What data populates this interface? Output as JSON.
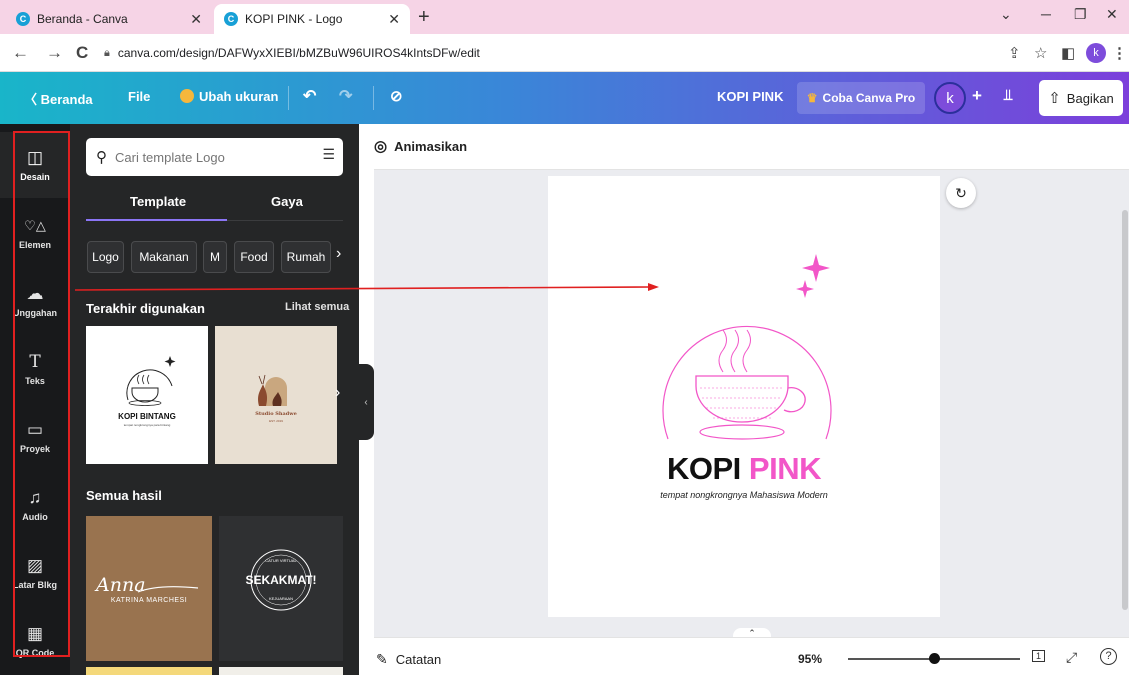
{
  "browser": {
    "tabs": [
      {
        "title": "Beranda - Canva",
        "active": false
      },
      {
        "title": "KOPI PINK - Logo",
        "active": true
      }
    ],
    "new_tab": "+",
    "url": "canva.com/design/DAFWyxXIEBI/bMZBuW96UIROS4kIntsDFw/edit",
    "profile_initial": "k"
  },
  "topbar": {
    "home_label": "Beranda",
    "file_label": "File",
    "resize_label": "Ubah ukuran",
    "design_title": "KOPI PINK",
    "pro_label": "Coba Canva Pro",
    "avatar_initial": "k",
    "add_label": "+",
    "share_label": "Bagikan"
  },
  "rail": {
    "items": [
      {
        "label": "Desain",
        "icon": "layout-icon",
        "glyph": "◫"
      },
      {
        "label": "Elemen",
        "icon": "shapes-icon",
        "glyph": "♡△"
      },
      {
        "label": "Unggahan",
        "icon": "cloud-upload-icon",
        "glyph": "☁"
      },
      {
        "label": "Teks",
        "icon": "text-icon",
        "glyph": "T"
      },
      {
        "label": "Proyek",
        "icon": "folder-icon",
        "glyph": "▭"
      },
      {
        "label": "Audio",
        "icon": "music-icon",
        "glyph": "♫"
      },
      {
        "label": "Latar Blkg",
        "icon": "background-pattern-icon",
        "glyph": "▨"
      },
      {
        "label": "QR Code",
        "icon": "qr-code-icon",
        "glyph": "▦"
      }
    ]
  },
  "panel": {
    "search_placeholder": "Cari template Logo",
    "tabs": {
      "template": "Template",
      "style": "Gaya"
    },
    "chips": [
      "Logo",
      "Makanan",
      "M",
      "Food",
      "Rumah"
    ],
    "recent_title": "Terakhir digunakan",
    "see_all": "Lihat semua",
    "recent": [
      {
        "title": "KOPI BINTANG",
        "subtitle": "tempat nongkrongnya para bintang"
      },
      {
        "title": "Studio Shadwe",
        "subtitle": "EST. 2019"
      }
    ],
    "all_results_title": "Semua hasil",
    "results": [
      {
        "script": "Anna",
        "name": "KATRINA MARCHESI"
      },
      {
        "title": "SEKAKMAT!",
        "ring_top": "CATUR VIRTUAL",
        "ring_bottom": "KEJUARAAN"
      }
    ]
  },
  "editor": {
    "animate_label": "Animasikan",
    "logo_word1": "KOPI",
    "logo_word2": "PINK",
    "tagline": "tempat nongkrongnya Mahasiswa Modern",
    "notes_label": "Catatan",
    "zoom": "95%",
    "zoom_fraction": 0.5,
    "page_number": "1"
  },
  "colors": {
    "brand_pink": "#f256c8",
    "annotation_red": "#e02020",
    "panel_bg": "#252627",
    "rail_bg": "#18191b",
    "accent_purple": "#8b75f5"
  }
}
